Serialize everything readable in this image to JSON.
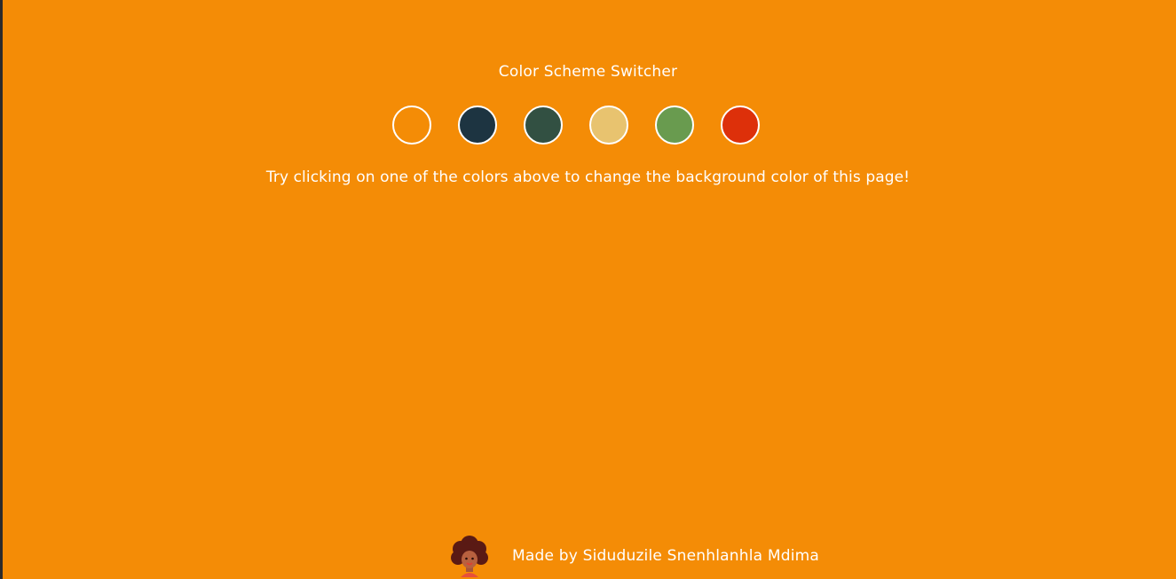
{
  "page": {
    "title": "Color Scheme Switcher",
    "hint": "Try clicking on one of the colors above to change the background color of this page!",
    "background": "#f48c06"
  },
  "swatches": [
    {
      "name": "orange",
      "color": "#f48c06"
    },
    {
      "name": "dark-navy",
      "color": "#1d3441"
    },
    {
      "name": "dark-green",
      "color": "#325042"
    },
    {
      "name": "sand",
      "color": "#e8c36f"
    },
    {
      "name": "green",
      "color": "#699b4f"
    },
    {
      "name": "red",
      "color": "#dd300a"
    }
  ],
  "footer": {
    "credit": "Made by Siduduzile Snenhlanhla Mdima",
    "avatar_icon": "avatar-icon"
  }
}
